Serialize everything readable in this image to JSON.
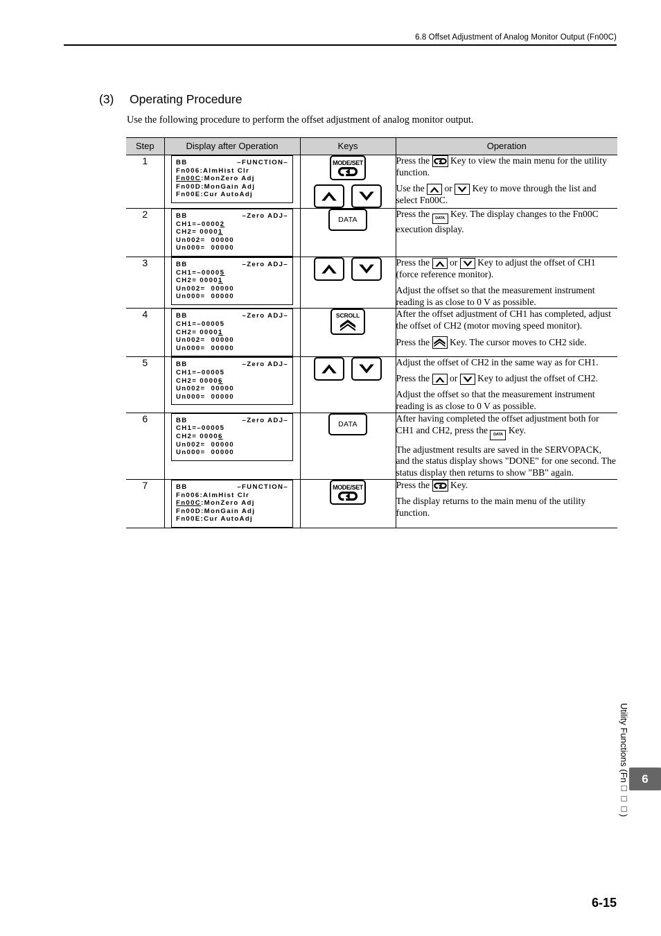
{
  "header": {
    "running_head": "6.8  Offset Adjustment of Analog Monitor Output (Fn00C)"
  },
  "section": {
    "number": "(3)",
    "title": "Operating Procedure",
    "intro": "Use the following procedure to perform the offset adjustment of analog monitor output."
  },
  "table": {
    "columns": [
      "Step",
      "Display after Operation",
      "Keys",
      "Operation"
    ],
    "rows": [
      {
        "step": "1",
        "display": {
          "status": "BB",
          "title": "–FUNCTION–",
          "line2": "Fn006:AlmHist Clr",
          "line3": "Fn00C:MonZero Adj",
          "line3_underline": "Fn00C",
          "line4": "Fn00D:MonGain Adj",
          "line5": "Fn00E:Cur AutoAdj"
        },
        "keys": [
          "mode-set-key",
          "up-arrow-key",
          "down-arrow-key"
        ],
        "key_labels": {
          "mode": "MODE/SET"
        },
        "operation": [
          {
            "pre": "Press the ",
            "icon": "mode-set-key",
            "post": " Key to view the main menu for the utility function."
          },
          {
            "pre": "Use the ",
            "icon": "up-arrow-key",
            "mid": " or ",
            "icon2": "down-arrow-key",
            "post": " Key to move through the list and select Fn00C."
          }
        ]
      },
      {
        "step": "2",
        "display": {
          "status": "BB",
          "title": "–Zero ADJ–",
          "ch1_label": "CH1=–",
          "ch1_value": "0000",
          "ch1_cursor": "2",
          "ch2_label": "CH2= ",
          "ch2_value": "0000",
          "ch2_cursor": "1",
          "un002": "Un002=  00000",
          "un000": "Un000=  00000"
        },
        "keys": [
          "data-key"
        ],
        "key_labels": {
          "data": "DATA"
        },
        "operation": [
          {
            "pre": "Press the ",
            "icon": "data-key",
            "post": " Key. The display changes to the Fn00C execution display."
          }
        ]
      },
      {
        "step": "3",
        "display": {
          "status": "BB",
          "title": "–Zero ADJ–",
          "ch1_label": "CH1=–",
          "ch1_value": "0000",
          "ch1_cursor": "5",
          "ch2_label": "CH2= ",
          "ch2_value": "0000",
          "ch2_cursor": "1",
          "un002": "Un002=  00000",
          "un000": "Un000=  00000"
        },
        "keys": [
          "up-arrow-key",
          "down-arrow-key"
        ],
        "operation": [
          {
            "pre": "Press the ",
            "icon": "up-arrow-key",
            "mid": " or ",
            "icon2": "down-arrow-key",
            "post": " Key to adjust the offset of CH1 (force reference monitor)."
          },
          {
            "pre": "Adjust the offset so that the measurement instrument reading is as close to 0 V as possible."
          }
        ]
      },
      {
        "step": "4",
        "display": {
          "status": "BB",
          "title": "–Zero ADJ–",
          "ch1_label": "CH1=–",
          "ch1_value": "00005",
          "ch2_label": "CH2= ",
          "ch2_value": "0000",
          "ch2_cursor": "1",
          "un002": "Un002=  00000",
          "un000": "Un000=  00000"
        },
        "keys": [
          "scroll-key"
        ],
        "key_labels": {
          "scroll": "SCROLL"
        },
        "operation": [
          {
            "pre": "After the offset adjustment of CH1 has completed, adjust the offset of CH2 (motor moving speed monitor)."
          },
          {
            "pre": "Press the ",
            "icon": "scroll-key",
            "post": " Key. The cursor moves to CH2 side."
          }
        ]
      },
      {
        "step": "5",
        "display": {
          "status": "BB",
          "title": "–Zero ADJ–",
          "ch1_label": "CH1=–",
          "ch1_value": "00005",
          "ch2_label": "CH2= ",
          "ch2_value": "0000",
          "ch2_cursor": "6",
          "un002": "Un002=  00000",
          "un000": "Un000=  00000"
        },
        "keys": [
          "up-arrow-key",
          "down-arrow-key"
        ],
        "operation": [
          {
            "pre": "Adjust the offset of CH2 in the same way as for CH1."
          },
          {
            "pre": "Press the ",
            "icon": "up-arrow-key",
            "mid": " or ",
            "icon2": "down-arrow-key",
            "post": " Key to adjust the offset of CH2."
          },
          {
            "pre": "Adjust the offset so that the measurement instrument reading is as close to 0 V as possible."
          }
        ]
      },
      {
        "step": "6",
        "display": {
          "status": "BB",
          "title": "–Zero ADJ–",
          "ch1_label": "CH1=–",
          "ch1_value": "00005",
          "ch2_label": "CH2= ",
          "ch2_value": "0000",
          "ch2_cursor": "6",
          "un002": "Un002=  00000",
          "un000": "Un000=  00000"
        },
        "keys": [
          "data-key"
        ],
        "operation": [
          {
            "pre": "After having completed the offset adjustment both for CH1 and CH2, press the ",
            "icon": "data-key",
            "post": " Key."
          },
          {
            "pre": "The adjustment results are saved in the SERVOPACK, and the status display shows \"DONE\" for one second. The status display then returns to show \"BB\" again."
          }
        ]
      },
      {
        "step": "7",
        "display": {
          "status": "BB",
          "title": "–FUNCTION–",
          "line2": "Fn006:AlmHist Clr",
          "line3": "Fn00C:MonZero Adj",
          "line3_underline": "Fn00C",
          "line4": "Fn00D:MonGain Adj",
          "line5": "Fn00E:Cur AutoAdj"
        },
        "keys": [
          "mode-set-key"
        ],
        "operation": [
          {
            "pre": "Press the ",
            "icon": "mode-set-key",
            "post": " Key."
          },
          {
            "pre": "The display returns to the main menu of the utility function."
          }
        ]
      }
    ]
  },
  "sidebar": {
    "tab_label": "Utility Functions (Fn□□□)",
    "chapter": "6"
  },
  "footer": {
    "page_number": "6-15"
  }
}
